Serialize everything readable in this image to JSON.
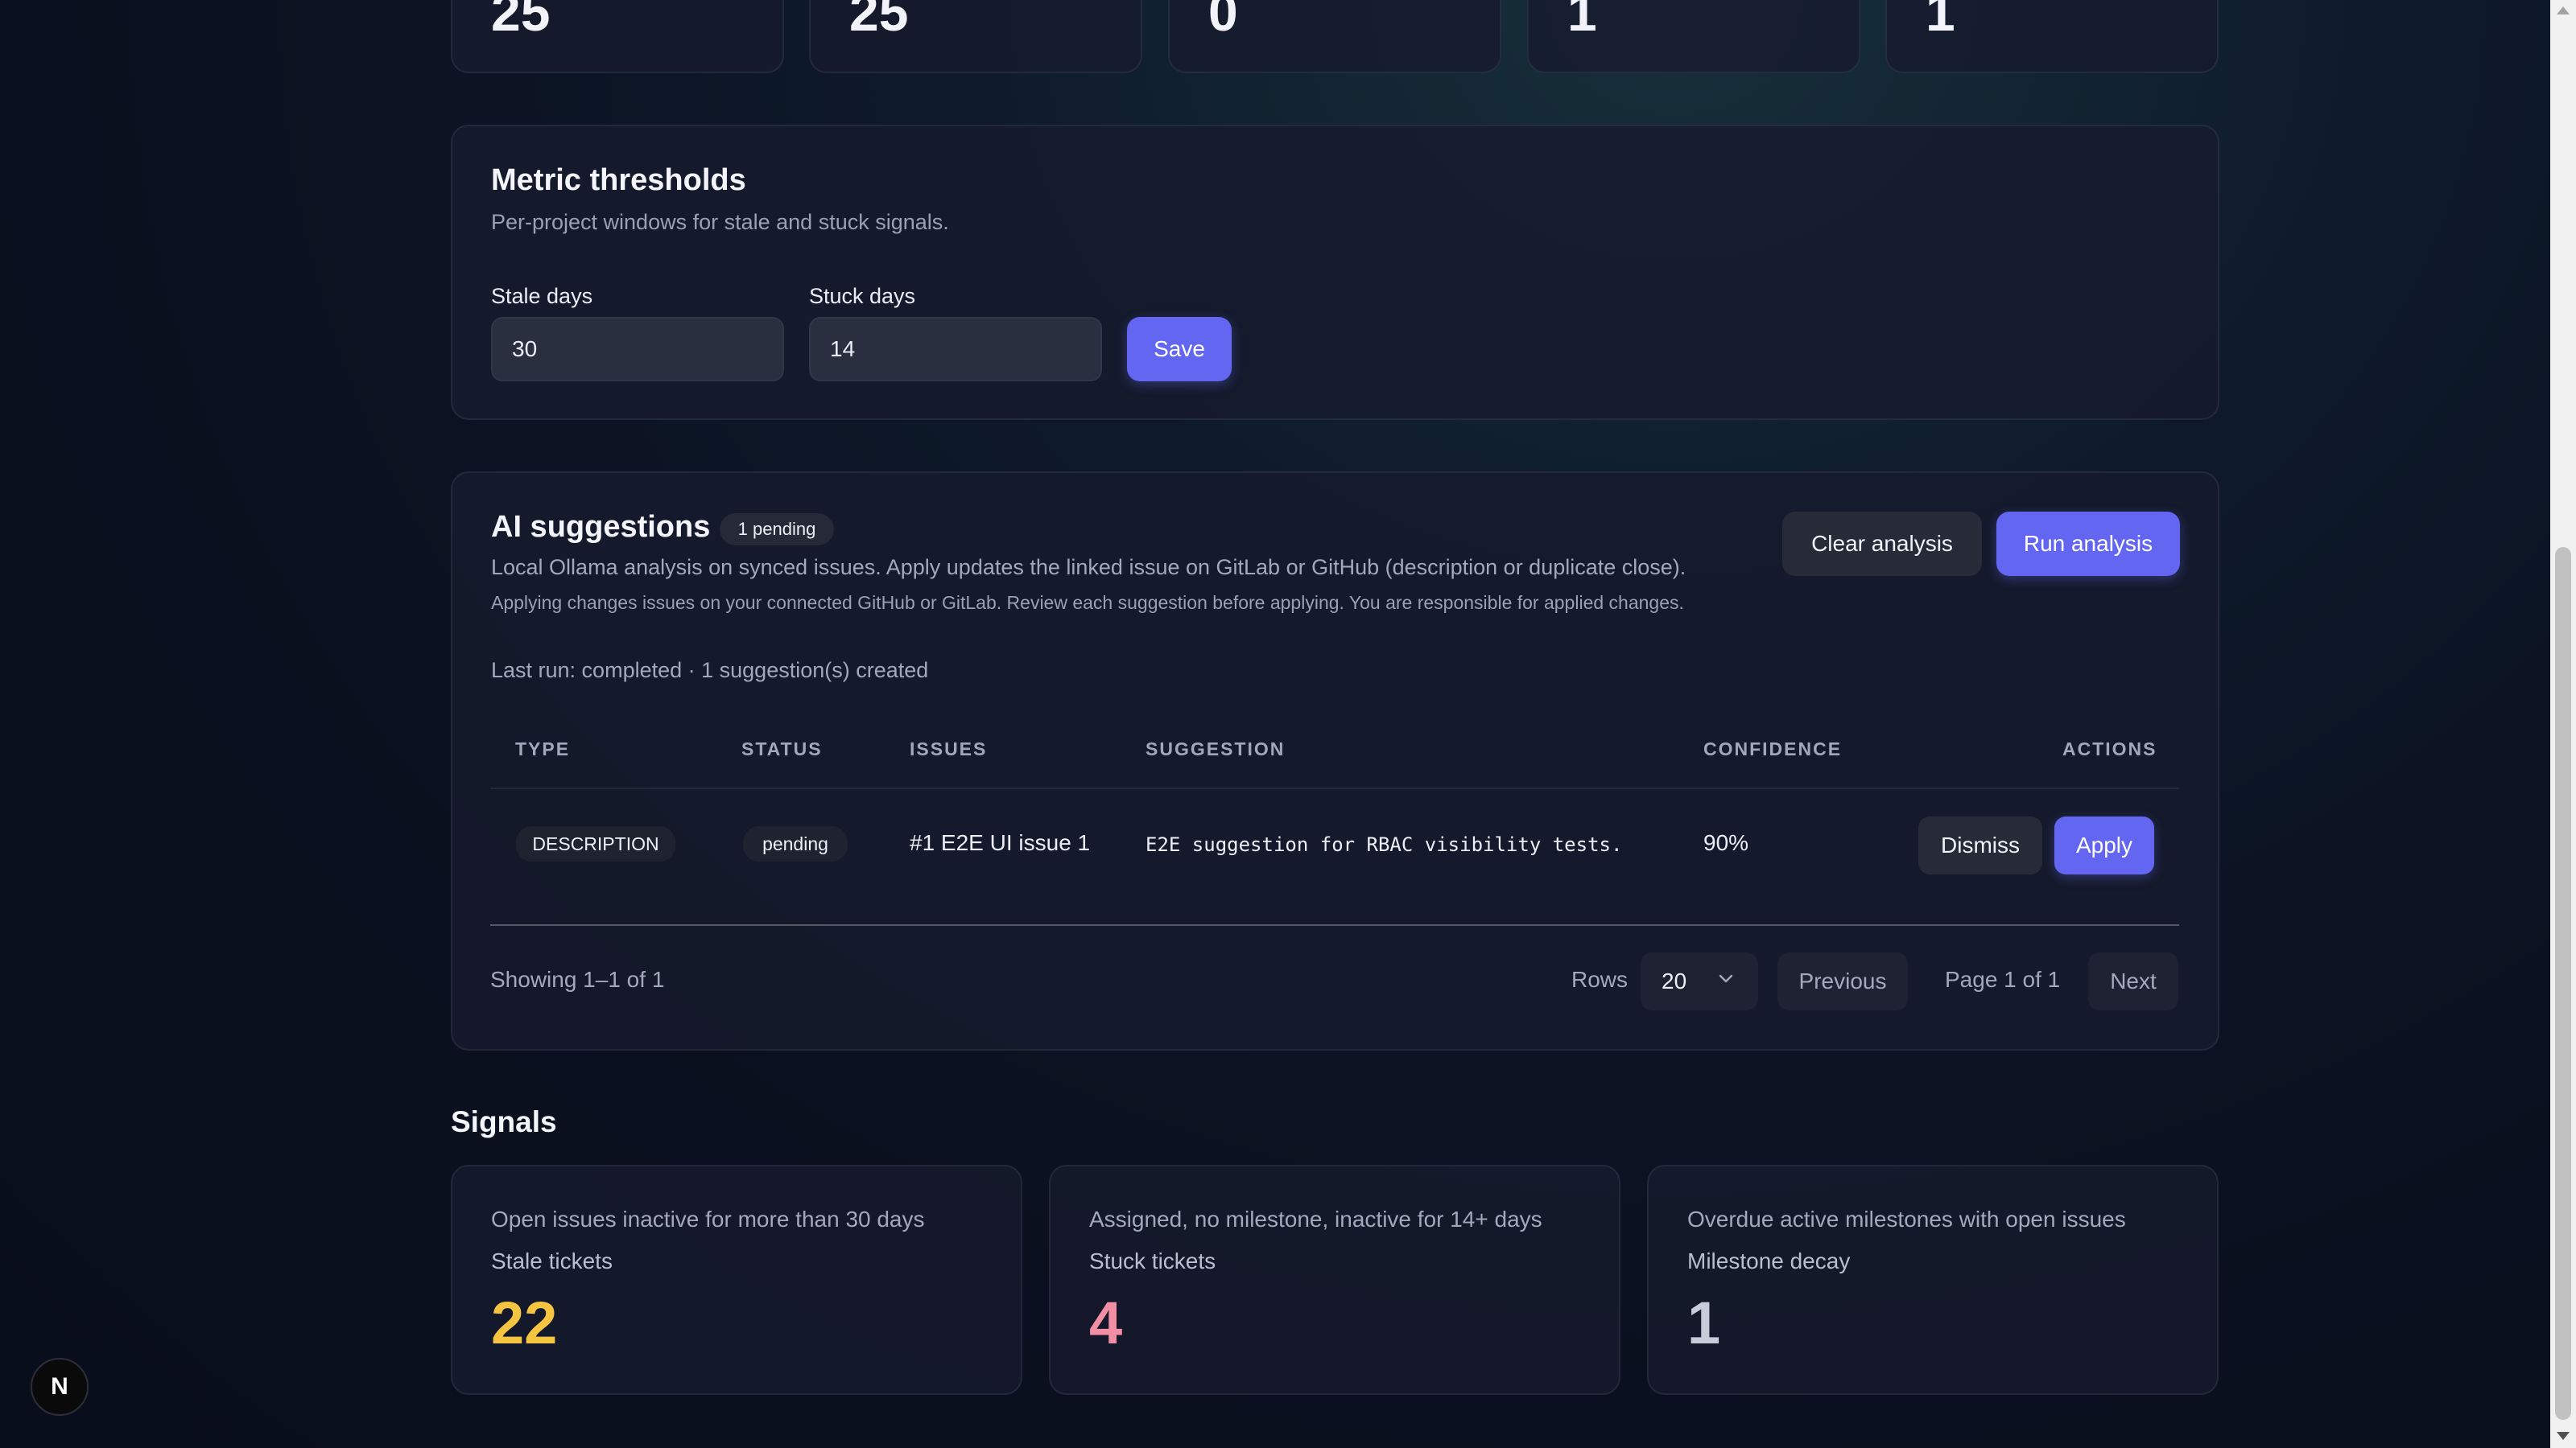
{
  "stats": {
    "values": [
      "25",
      "25",
      "0",
      "1",
      "1"
    ]
  },
  "thresholds": {
    "title": "Metric thresholds",
    "subtitle": "Per-project windows for stale and stuck signals.",
    "stale_label": "Stale days",
    "stale_value": "30",
    "stuck_label": "Stuck days",
    "stuck_value": "14",
    "save_label": "Save"
  },
  "ai": {
    "title": "AI suggestions",
    "pending_badge": "1 pending",
    "description": "Local Ollama analysis on synced issues. Apply updates the linked issue on GitLab or GitHub (description or duplicate close).",
    "warning": "Applying changes issues on your connected GitHub or GitLab. Review each suggestion before applying. You are responsible for applied changes.",
    "clear_label": "Clear analysis",
    "run_label": "Run analysis",
    "last_run": "Last run: completed · 1 suggestion(s) created",
    "columns": {
      "type": "TYPE",
      "status": "STATUS",
      "issues": "ISSUES",
      "suggestion": "SUGGESTION",
      "confidence": "CONFIDENCE",
      "actions": "ACTIONS"
    },
    "rows": [
      {
        "type": "DESCRIPTION",
        "status": "pending",
        "issue": "#1 E2E UI issue 1",
        "suggestion": "E2E suggestion for RBAC visibility tests.",
        "confidence": "90%",
        "dismiss_label": "Dismiss",
        "apply_label": "Apply"
      }
    ],
    "pagination": {
      "showing": "Showing 1–1 of 1",
      "rows_label": "Rows",
      "rows_value": "20",
      "previous_label": "Previous",
      "page_text": "Page 1 of 1",
      "next_label": "Next"
    }
  },
  "signals": {
    "title": "Signals",
    "cards": [
      {
        "description": "Open issues inactive for more than 30 days",
        "title": "Stale tickets",
        "value": "22",
        "color": "#f5c542"
      },
      {
        "description": "Assigned, no milestone, inactive for 14+ days",
        "title": "Stuck tickets",
        "value": "4",
        "color": "#f28fa5"
      },
      {
        "description": "Overdue active milestones with open issues",
        "title": "Milestone decay",
        "value": "1",
        "color": "#c9ccd8"
      }
    ]
  },
  "colors": {
    "accent": "#6366f1",
    "background": "#0b1120"
  },
  "icons": {
    "dev_badge": "N"
  }
}
